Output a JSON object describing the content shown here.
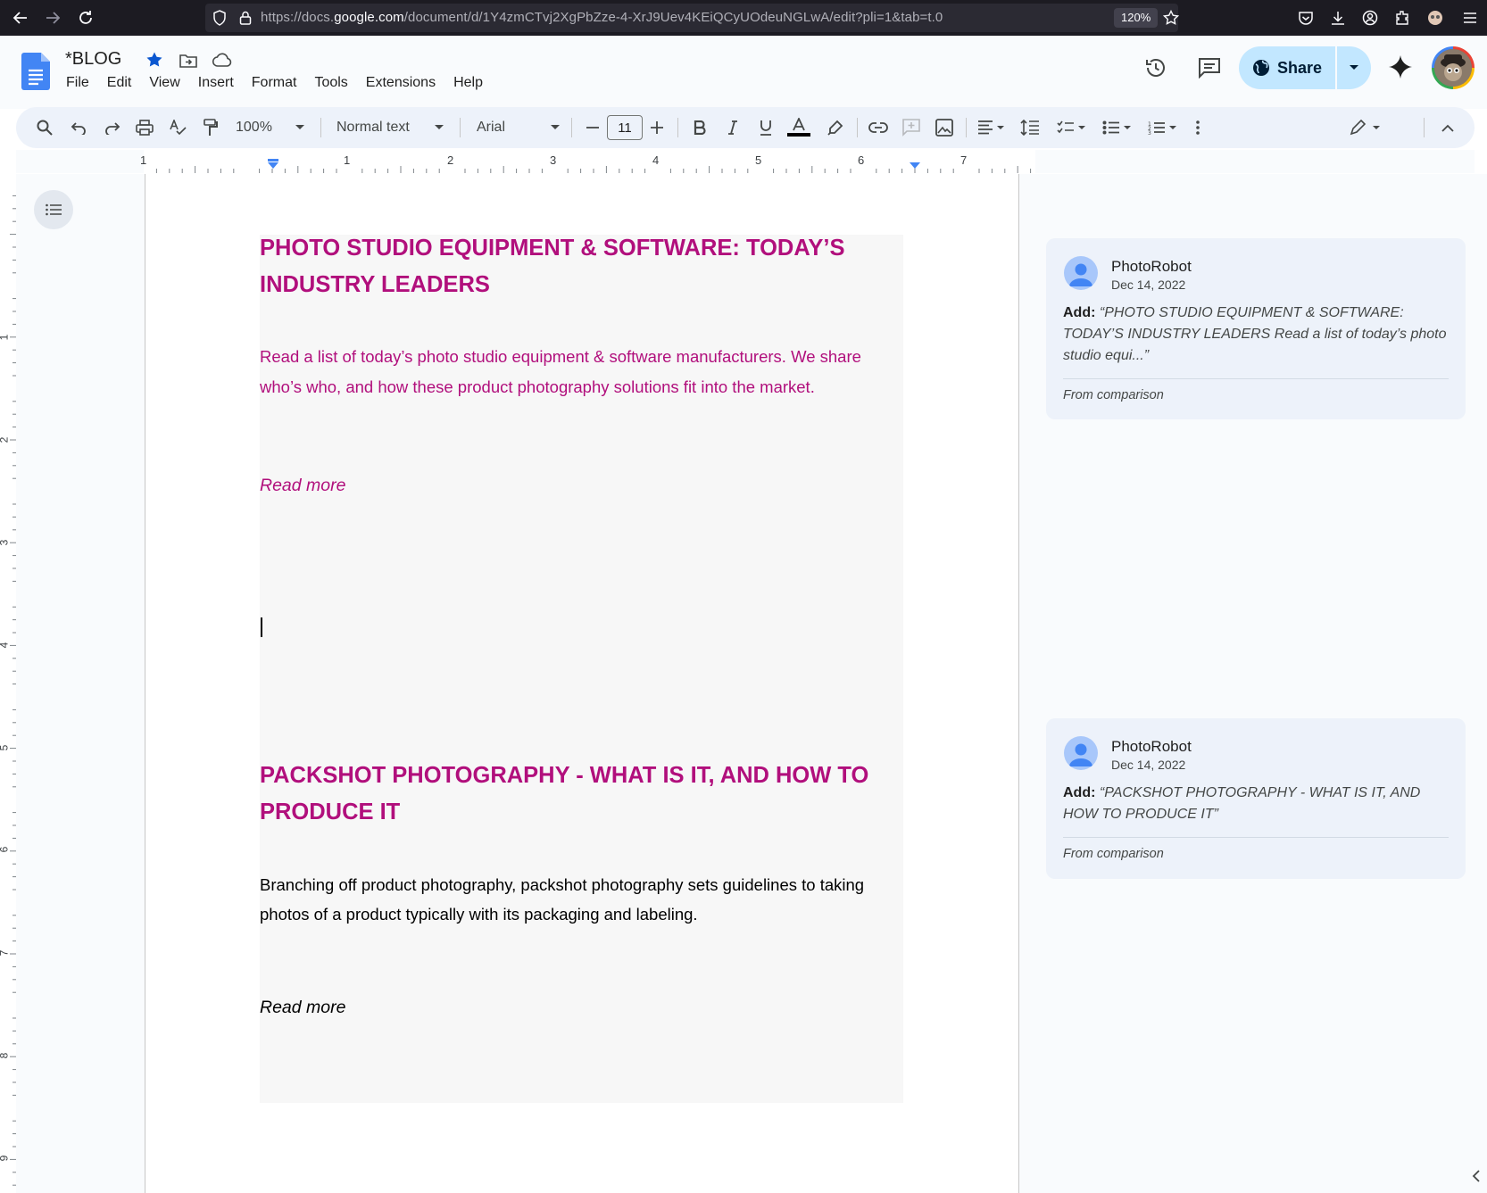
{
  "browser": {
    "url_prefix": "https://docs.",
    "url_domain": "google.com",
    "url_suffix": "/document/d/1Y4zmCTvj2XgPbZze-4-XrJ9Uev4KEiQCyUOdeuNGLwA/edit?pli=1&tab=t.0",
    "zoom": "120%"
  },
  "doc": {
    "title": "*BLOG",
    "menu": [
      "File",
      "Edit",
      "View",
      "Insert",
      "Format",
      "Tools",
      "Extensions",
      "Help"
    ],
    "share_label": "Share"
  },
  "toolbar": {
    "zoom": "100%",
    "style": "Normal text",
    "font": "Arial",
    "font_size": "11"
  },
  "ruler": {
    "h_labels": [
      "1",
      "1",
      "2",
      "3",
      "4",
      "5",
      "6",
      "7"
    ],
    "v_labels": [
      "1",
      "2",
      "3",
      "4",
      "5",
      "6",
      "7",
      "8",
      "9"
    ]
  },
  "content": {
    "section1": {
      "heading": "PHOTO STUDIO EQUIPMENT & SOFTWARE: TODAY’S INDUSTRY LEADERS",
      "lead": "Read a list of today’s photo studio equipment & software manufacturers. We share who’s who, and how these product photography solutions fit into the market.",
      "read_more": "Read more"
    },
    "section2": {
      "heading": "PACKSHOT PHOTOGRAPHY - WHAT IS IT, AND HOW TO PRODUCE IT",
      "body": "Branching off product photography, packshot photography sets guidelines to taking photos of a product typically with its packaging and labeling.",
      "read_more": "Read more"
    }
  },
  "comments": [
    {
      "author": "PhotoRobot",
      "date": "Dec 14, 2022",
      "action": "Add:",
      "quote": "“PHOTO STUDIO EQUIPMENT & SOFTWARE: TODAY’S INDUSTRY LEADERS Read a list of today’s photo studio equi...”",
      "source": "From comparison"
    },
    {
      "author": "PhotoRobot",
      "date": "Dec 14, 2022",
      "action": "Add:",
      "quote": "“PACKSHOT PHOTOGRAPHY - WHAT IS IT, AND HOW TO PRODUCE IT”",
      "source": "From comparison"
    }
  ],
  "colors": {
    "heading": "#b10f7c",
    "accent": "#0b57d0",
    "share_bg": "#c2e7ff"
  }
}
